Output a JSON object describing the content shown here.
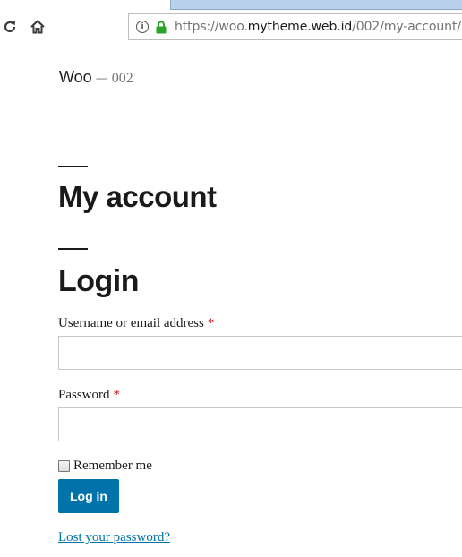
{
  "browser": {
    "url_prefix": "https://woo.",
    "url_host": "mytheme.web.id",
    "url_path": "/002/my-account/",
    "icons": {
      "reload": "reload-icon",
      "home": "home-icon",
      "info": "info-icon",
      "lock": "lock-icon"
    },
    "colors": {
      "lock": "#2aa52a",
      "tab_fill": "#b9d1ea"
    }
  },
  "site": {
    "name": "Woo",
    "separator": "—",
    "description": "002"
  },
  "page": {
    "title": "My account",
    "section_heading": "Login"
  },
  "form": {
    "username_label": "Username or email address",
    "password_label": "Password",
    "required_marker": "*",
    "username_value": "",
    "password_value": "",
    "remember_label": "Remember me",
    "remember_checked": false,
    "submit_label": "Log in",
    "lost_password_link": "Lost your password?"
  },
  "colors": {
    "accent": "#0073aa",
    "required": "#cc1818",
    "text": "#1a1a1a",
    "muted": "#767676"
  }
}
